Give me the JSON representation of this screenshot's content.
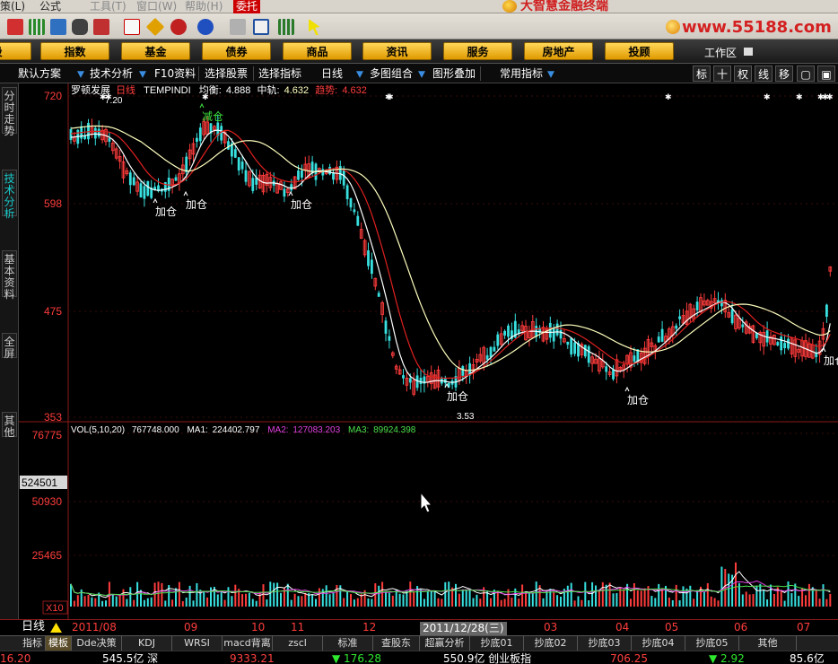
{
  "menubar": {
    "items": [
      {
        "label": "策(L)",
        "dim": false
      },
      {
        "label": "公式",
        "dim": false
      },
      {
        "label": "工具(T)",
        "dim": true
      },
      {
        "label": "窗口(W)",
        "dim": true
      },
      {
        "label": "帮助(H)",
        "dim": true
      },
      {
        "label": "委托",
        "active": true
      }
    ],
    "app_title": "大智慧金融终端"
  },
  "iconbar": {
    "site_url": "www.55188.com",
    "icons": [
      "flag-icon",
      "bars-icon",
      "markets-icon",
      "binoculars-icon",
      "alert-icon",
      "formula-icon",
      "diamond-icon",
      "f10-icon",
      "coin-icon",
      "notes-icon",
      "window-icon",
      "bar-chart-icon",
      "help-pointer-icon"
    ]
  },
  "nav": {
    "buttons": [
      "股",
      "指数",
      "基金",
      "债券",
      "商品",
      "资讯",
      "服务",
      "房地产",
      "投顾"
    ],
    "workspace": "工作区"
  },
  "chart_toolbar": {
    "items": [
      "默认方案",
      "技术分析",
      "F10资料",
      "选择股票",
      "选择指标",
      "日线",
      "多图组合",
      "图形叠加",
      "常用指标"
    ],
    "right_buttons": [
      {
        "label": "标",
        "on": true
      },
      {
        "label": "十",
        "on": false
      },
      {
        "label": "权",
        "on": true
      },
      {
        "label": "线",
        "on": false
      },
      {
        "label": "移",
        "on": false
      },
      {
        "label": "▢",
        "on": false
      },
      {
        "label": "▣",
        "on": false
      }
    ]
  },
  "side_tabs": [
    {
      "label": "分时走势",
      "on": false
    },
    {
      "label": "技术分析",
      "on": true
    },
    {
      "label": "基本资料",
      "on": false
    },
    {
      "label": "全屏",
      "on": false
    },
    {
      "label": "其他",
      "on": false
    }
  ],
  "price_panel": {
    "stock_name": "罗顿发展",
    "period": "日线",
    "indicator": "TEMPINDI",
    "label_balance": "均衡:",
    "balance_value": "4.888",
    "label_mid": "中轨:",
    "mid_value": "4.632",
    "label_trend": "趋势:",
    "trend_value": "4.632",
    "high_label": "7.20",
    "low_label": "3.53",
    "y_ticks": [
      "720",
      "598",
      "475",
      "353"
    ],
    "signals": [
      {
        "text": "加仓"
      },
      {
        "text": "加仓"
      },
      {
        "text": "减仓"
      },
      {
        "text": "加仓"
      },
      {
        "text": "加仓"
      },
      {
        "text": "加仓"
      },
      {
        "text": "加仓"
      }
    ]
  },
  "volume_panel": {
    "label": "VOL(5,10,20)",
    "value": "767748.000",
    "ma1_label": "MA1:",
    "ma1": "224402.797",
    "ma2_label": "MA2:",
    "ma2": "127083.203",
    "ma3_label": "MA3:",
    "ma3": "89924.398",
    "y_ticks": [
      "76775",
      "50930",
      "25465"
    ],
    "unit": "X10",
    "cursor_value": "524501"
  },
  "date_bar": {
    "period": "日线",
    "cursor_date": "2011/12/28(三)",
    "months": [
      "2011/08",
      "09",
      "10",
      "11",
      "12",
      "2011/12/28",
      "03",
      "04",
      "05",
      "06",
      "07"
    ]
  },
  "indicator_tabs": [
    {
      "label": "指标",
      "on": false
    },
    {
      "label": "模板",
      "on": true
    },
    {
      "label": "Dde决策",
      "on": false
    },
    {
      "label": "KDJ",
      "on": false
    },
    {
      "label": "WRSI",
      "on": false
    },
    {
      "label": "macd背离",
      "on": false
    },
    {
      "label": "zscl",
      "on": false
    },
    {
      "label": "标准",
      "on": false
    },
    {
      "label": "查股东",
      "on": false
    },
    {
      "label": "超赢分析",
      "on": false
    },
    {
      "label": "抄底01",
      "on": false
    },
    {
      "label": "抄底02",
      "on": false
    },
    {
      "label": "抄底03",
      "on": false
    },
    {
      "label": "抄底04",
      "on": false
    },
    {
      "label": "抄底05",
      "on": false
    },
    {
      "label": "其他",
      "on": false
    }
  ],
  "ticker": {
    "items": [
      {
        "text": "16.20",
        "color": "#ff4040"
      },
      {
        "text": "545.5亿 深",
        "color": "#ffffff"
      },
      {
        "text": "9333.21",
        "color": "#ff4040"
      },
      {
        "text": "▼ 176.28",
        "color": "#2ee82e"
      },
      {
        "text": "550.9亿 创业板指",
        "color": "#ffffff"
      },
      {
        "text": "706.25",
        "color": "#ff4040"
      },
      {
        "text": "▼ 2.92",
        "color": "#2ee82e"
      },
      {
        "text": "85.6亿",
        "color": "#ffffff"
      }
    ]
  },
  "colors": {
    "up": "#ff3c3c",
    "down": "#38e0e0",
    "balance_line": "#ffffff",
    "trend_line": "#e02020",
    "mid_line": "#ffffbf",
    "ma2": "#e040e0",
    "ma3": "#4ce04c"
  }
}
